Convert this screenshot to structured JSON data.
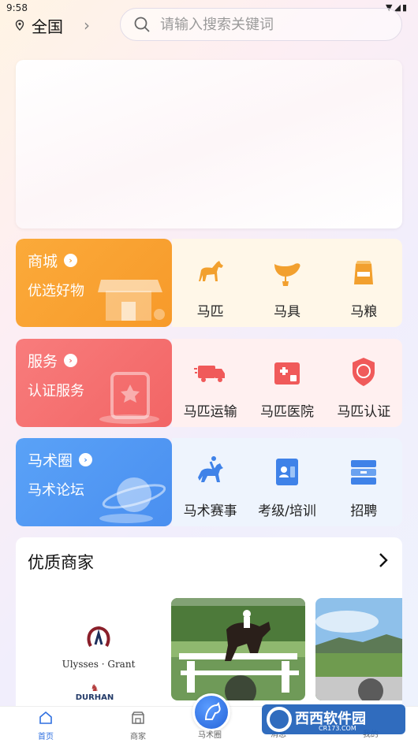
{
  "status_bar": {
    "time": "9:58"
  },
  "location": {
    "label": "全国"
  },
  "search": {
    "placeholder": "请输入搜索关键词"
  },
  "categories": [
    {
      "title": "商城",
      "subtitle": "优选好物",
      "items": [
        {
          "label": "马匹",
          "icon": "horse-icon"
        },
        {
          "label": "马具",
          "icon": "saddle-icon"
        },
        {
          "label": "马粮",
          "icon": "feed-bag-icon"
        }
      ]
    },
    {
      "title": "服务",
      "subtitle": "认证服务",
      "items": [
        {
          "label": "马匹运输",
          "icon": "truck-icon"
        },
        {
          "label": "马匹医院",
          "icon": "hospital-icon"
        },
        {
          "label": "马匹认证",
          "icon": "certificate-badge-icon"
        }
      ]
    },
    {
      "title": "马术圈",
      "subtitle": "马术论坛",
      "items": [
        {
          "label": "马术赛事",
          "icon": "rider-icon"
        },
        {
          "label": "考级/培训",
          "icon": "training-card-icon"
        },
        {
          "label": "招聘",
          "icon": "cabinet-icon"
        }
      ]
    }
  ],
  "merchants": {
    "title": "优质商家",
    "logos": [
      {
        "name": "Ulysses · Grant"
      },
      {
        "name": "DURHAN"
      }
    ]
  },
  "nav": {
    "items": [
      {
        "label": "首页",
        "active": true
      },
      {
        "label": "商家"
      },
      {
        "label": "马术圈"
      },
      {
        "label": "消息"
      },
      {
        "label": "我的"
      }
    ]
  },
  "watermark": {
    "text": "西西软件园",
    "url": "CR173.COM"
  },
  "colors": {
    "shop": "#f8a233",
    "service": "#f26f6f",
    "circle": "#4c91f1",
    "nav_active": "#2f6fe0"
  }
}
